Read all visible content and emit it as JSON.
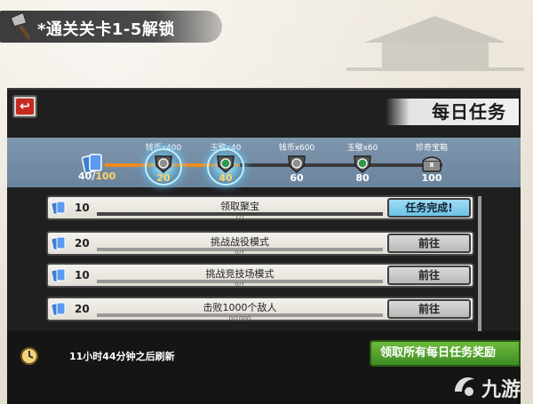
{
  "caption": {
    "text": "*通关关卡1-5解锁"
  },
  "panel": {
    "title": "每日任务"
  },
  "progress": {
    "current": "40",
    "max": "100",
    "fill_fraction": 0.4,
    "milestones": [
      {
        "reward": "钱币x400",
        "value": "20",
        "reached": true,
        "icon": "silver-coin-shield-icon"
      },
      {
        "reward": "玉璧x40",
        "value": "40",
        "reached": true,
        "icon": "jade-shield-icon"
      },
      {
        "reward": "钱币x600",
        "value": "60",
        "reached": false,
        "icon": "silver-coin-shield-icon"
      },
      {
        "reward": "玉璧x60",
        "value": "80",
        "reached": false,
        "icon": "jade-shield-icon"
      },
      {
        "reward": "珍奇宝箱",
        "value": "100",
        "reached": false,
        "icon": "treasure-chest-icon"
      }
    ]
  },
  "tasks": [
    {
      "reward": "10",
      "name": "领取聚宝",
      "progress": "1/1",
      "progress_fraction": 1,
      "action": "任务完成!",
      "status": "done"
    },
    {
      "reward": "20",
      "name": "挑战战役模式",
      "progress": "0/1",
      "progress_fraction": 0,
      "action": "前往",
      "status": "go"
    },
    {
      "reward": "10",
      "name": "挑战竞技场模式",
      "progress": "0/1",
      "progress_fraction": 0,
      "action": "前往",
      "status": "go"
    },
    {
      "reward": "20",
      "name": "击败1000个敌人",
      "progress": "0/1000",
      "progress_fraction": 0,
      "action": "前往",
      "status": "go"
    }
  ],
  "footer": {
    "refresh_text": "11小时44分钟之后刷新",
    "claim_all_label": "领取所有每日任务奖励"
  },
  "watermark": {
    "text": "九游",
    "logo_icon": "nine-game-logo-icon"
  },
  "colors": {
    "accent_orange": "#f08a1a",
    "done_blue": "#6cc3e6",
    "claim_green": "#3f8d24",
    "back_red": "#c52b20"
  }
}
